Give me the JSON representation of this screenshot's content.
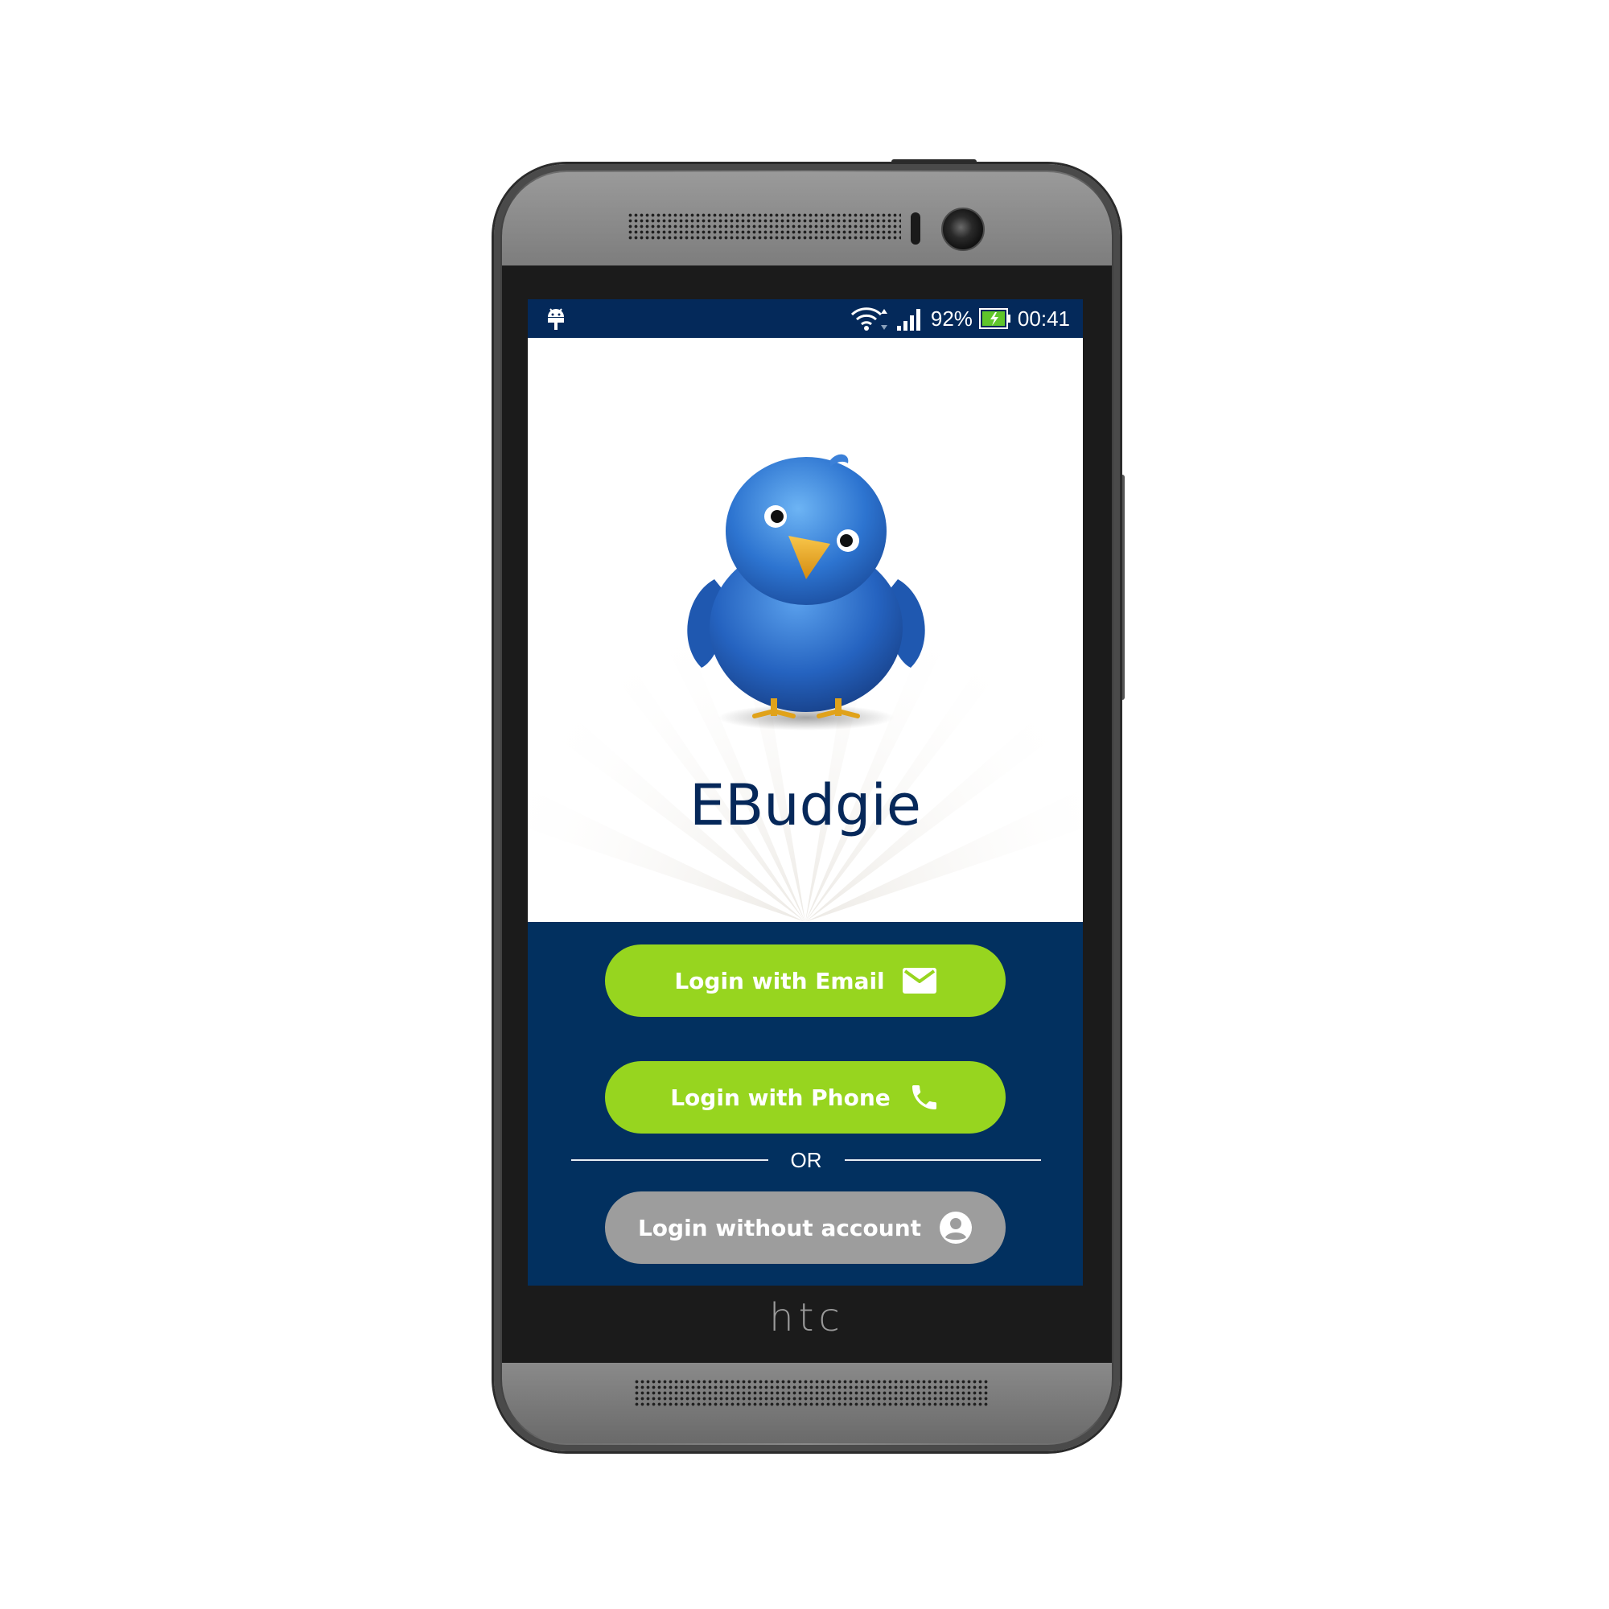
{
  "device": {
    "brand": "htc"
  },
  "status_bar": {
    "battery_percent": "92%",
    "time": "00:41",
    "icons": [
      "android-debug-icon",
      "wifi-icon",
      "signal-icon",
      "battery-charging-icon"
    ]
  },
  "app": {
    "name": "EBudgie",
    "logo": "blue-bird-mascot"
  },
  "login": {
    "email_label": "Login with Email",
    "phone_label": "Login with Phone",
    "divider_label": "OR",
    "guest_label": "Login without account"
  },
  "colors": {
    "status_bar": "#04295a",
    "panel_background": "#02305f",
    "primary_button": "#97d51f",
    "secondary_button": "#9d9d9d",
    "title_text": "#06285a"
  }
}
